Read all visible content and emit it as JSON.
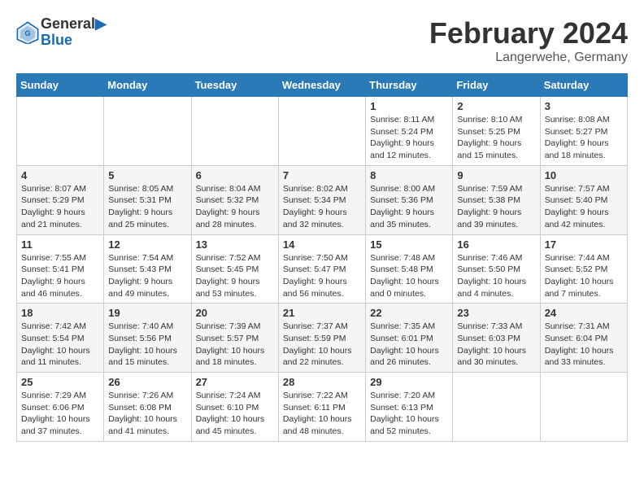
{
  "header": {
    "logo_line1": "General",
    "logo_line2": "Blue",
    "month_title": "February 2024",
    "location": "Langerwehe, Germany"
  },
  "weekdays": [
    "Sunday",
    "Monday",
    "Tuesday",
    "Wednesday",
    "Thursday",
    "Friday",
    "Saturday"
  ],
  "weeks": [
    [
      {
        "day": "",
        "sunrise": "",
        "sunset": "",
        "daylight": ""
      },
      {
        "day": "",
        "sunrise": "",
        "sunset": "",
        "daylight": ""
      },
      {
        "day": "",
        "sunrise": "",
        "sunset": "",
        "daylight": ""
      },
      {
        "day": "",
        "sunrise": "",
        "sunset": "",
        "daylight": ""
      },
      {
        "day": "1",
        "sunrise": "Sunrise: 8:11 AM",
        "sunset": "Sunset: 5:24 PM",
        "daylight": "Daylight: 9 hours and 12 minutes."
      },
      {
        "day": "2",
        "sunrise": "Sunrise: 8:10 AM",
        "sunset": "Sunset: 5:25 PM",
        "daylight": "Daylight: 9 hours and 15 minutes."
      },
      {
        "day": "3",
        "sunrise": "Sunrise: 8:08 AM",
        "sunset": "Sunset: 5:27 PM",
        "daylight": "Daylight: 9 hours and 18 minutes."
      }
    ],
    [
      {
        "day": "4",
        "sunrise": "Sunrise: 8:07 AM",
        "sunset": "Sunset: 5:29 PM",
        "daylight": "Daylight: 9 hours and 21 minutes."
      },
      {
        "day": "5",
        "sunrise": "Sunrise: 8:05 AM",
        "sunset": "Sunset: 5:31 PM",
        "daylight": "Daylight: 9 hours and 25 minutes."
      },
      {
        "day": "6",
        "sunrise": "Sunrise: 8:04 AM",
        "sunset": "Sunset: 5:32 PM",
        "daylight": "Daylight: 9 hours and 28 minutes."
      },
      {
        "day": "7",
        "sunrise": "Sunrise: 8:02 AM",
        "sunset": "Sunset: 5:34 PM",
        "daylight": "Daylight: 9 hours and 32 minutes."
      },
      {
        "day": "8",
        "sunrise": "Sunrise: 8:00 AM",
        "sunset": "Sunset: 5:36 PM",
        "daylight": "Daylight: 9 hours and 35 minutes."
      },
      {
        "day": "9",
        "sunrise": "Sunrise: 7:59 AM",
        "sunset": "Sunset: 5:38 PM",
        "daylight": "Daylight: 9 hours and 39 minutes."
      },
      {
        "day": "10",
        "sunrise": "Sunrise: 7:57 AM",
        "sunset": "Sunset: 5:40 PM",
        "daylight": "Daylight: 9 hours and 42 minutes."
      }
    ],
    [
      {
        "day": "11",
        "sunrise": "Sunrise: 7:55 AM",
        "sunset": "Sunset: 5:41 PM",
        "daylight": "Daylight: 9 hours and 46 minutes."
      },
      {
        "day": "12",
        "sunrise": "Sunrise: 7:54 AM",
        "sunset": "Sunset: 5:43 PM",
        "daylight": "Daylight: 9 hours and 49 minutes."
      },
      {
        "day": "13",
        "sunrise": "Sunrise: 7:52 AM",
        "sunset": "Sunset: 5:45 PM",
        "daylight": "Daylight: 9 hours and 53 minutes."
      },
      {
        "day": "14",
        "sunrise": "Sunrise: 7:50 AM",
        "sunset": "Sunset: 5:47 PM",
        "daylight": "Daylight: 9 hours and 56 minutes."
      },
      {
        "day": "15",
        "sunrise": "Sunrise: 7:48 AM",
        "sunset": "Sunset: 5:48 PM",
        "daylight": "Daylight: 10 hours and 0 minutes."
      },
      {
        "day": "16",
        "sunrise": "Sunrise: 7:46 AM",
        "sunset": "Sunset: 5:50 PM",
        "daylight": "Daylight: 10 hours and 4 minutes."
      },
      {
        "day": "17",
        "sunrise": "Sunrise: 7:44 AM",
        "sunset": "Sunset: 5:52 PM",
        "daylight": "Daylight: 10 hours and 7 minutes."
      }
    ],
    [
      {
        "day": "18",
        "sunrise": "Sunrise: 7:42 AM",
        "sunset": "Sunset: 5:54 PM",
        "daylight": "Daylight: 10 hours and 11 minutes."
      },
      {
        "day": "19",
        "sunrise": "Sunrise: 7:40 AM",
        "sunset": "Sunset: 5:56 PM",
        "daylight": "Daylight: 10 hours and 15 minutes."
      },
      {
        "day": "20",
        "sunrise": "Sunrise: 7:39 AM",
        "sunset": "Sunset: 5:57 PM",
        "daylight": "Daylight: 10 hours and 18 minutes."
      },
      {
        "day": "21",
        "sunrise": "Sunrise: 7:37 AM",
        "sunset": "Sunset: 5:59 PM",
        "daylight": "Daylight: 10 hours and 22 minutes."
      },
      {
        "day": "22",
        "sunrise": "Sunrise: 7:35 AM",
        "sunset": "Sunset: 6:01 PM",
        "daylight": "Daylight: 10 hours and 26 minutes."
      },
      {
        "day": "23",
        "sunrise": "Sunrise: 7:33 AM",
        "sunset": "Sunset: 6:03 PM",
        "daylight": "Daylight: 10 hours and 30 minutes."
      },
      {
        "day": "24",
        "sunrise": "Sunrise: 7:31 AM",
        "sunset": "Sunset: 6:04 PM",
        "daylight": "Daylight: 10 hours and 33 minutes."
      }
    ],
    [
      {
        "day": "25",
        "sunrise": "Sunrise: 7:29 AM",
        "sunset": "Sunset: 6:06 PM",
        "daylight": "Daylight: 10 hours and 37 minutes."
      },
      {
        "day": "26",
        "sunrise": "Sunrise: 7:26 AM",
        "sunset": "Sunset: 6:08 PM",
        "daylight": "Daylight: 10 hours and 41 minutes."
      },
      {
        "day": "27",
        "sunrise": "Sunrise: 7:24 AM",
        "sunset": "Sunset: 6:10 PM",
        "daylight": "Daylight: 10 hours and 45 minutes."
      },
      {
        "day": "28",
        "sunrise": "Sunrise: 7:22 AM",
        "sunset": "Sunset: 6:11 PM",
        "daylight": "Daylight: 10 hours and 48 minutes."
      },
      {
        "day": "29",
        "sunrise": "Sunrise: 7:20 AM",
        "sunset": "Sunset: 6:13 PM",
        "daylight": "Daylight: 10 hours and 52 minutes."
      },
      {
        "day": "",
        "sunrise": "",
        "sunset": "",
        "daylight": ""
      },
      {
        "day": "",
        "sunrise": "",
        "sunset": "",
        "daylight": ""
      }
    ]
  ]
}
